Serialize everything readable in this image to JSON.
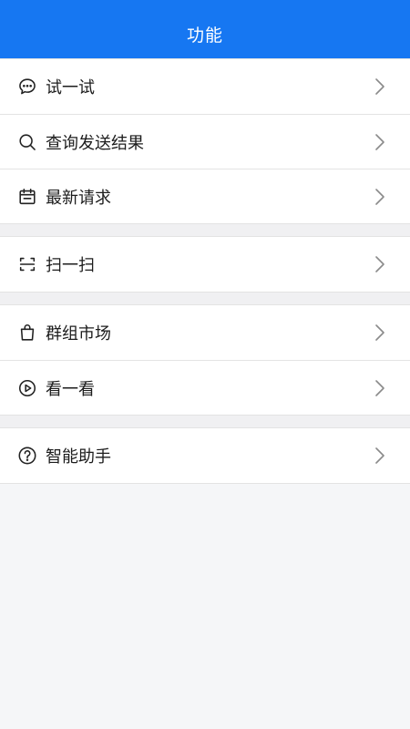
{
  "header": {
    "title": "功能"
  },
  "groups": [
    {
      "items": [
        {
          "label": "试一试",
          "icon": "chat-bubble-icon"
        },
        {
          "label": "查询发送结果",
          "icon": "search-icon"
        },
        {
          "label": "最新请求",
          "icon": "calendar-icon"
        }
      ]
    },
    {
      "items": [
        {
          "label": "扫一扫",
          "icon": "scan-icon"
        }
      ]
    },
    {
      "items": [
        {
          "label": "群组市场",
          "icon": "shopping-bag-icon"
        },
        {
          "label": "看一看",
          "icon": "play-circle-icon"
        }
      ]
    },
    {
      "items": [
        {
          "label": "智能助手",
          "icon": "question-circle-icon"
        }
      ]
    }
  ],
  "colors": {
    "header_bg": "#1677f2",
    "header_text": "#ffffff",
    "page_bg": "#f5f6f8",
    "chevron": "#8a8a8a"
  }
}
